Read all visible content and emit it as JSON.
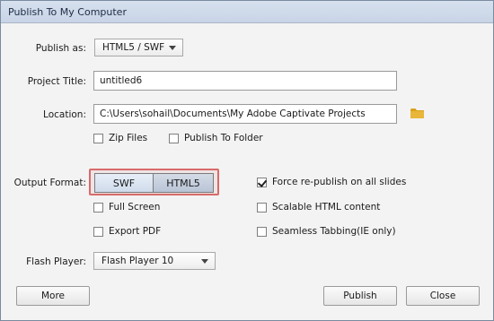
{
  "window": {
    "title": "Publish To My Computer"
  },
  "publish_as": {
    "label": "Publish as:",
    "value": "HTML5 / SWF"
  },
  "project_title": {
    "label": "Project Title:",
    "value": "untitled6"
  },
  "location": {
    "label": "Location:",
    "value": "C:\\Users\\sohail\\Documents\\My Adobe Captivate Projects",
    "icon": "folder-icon"
  },
  "options": {
    "zip_files": {
      "label": "Zip Files",
      "checked": false
    },
    "publish_to_folder": {
      "label": "Publish To Folder",
      "checked": false
    }
  },
  "output_format": {
    "label": "Output Format:",
    "swf": "SWF",
    "html5": "HTML5"
  },
  "left_checks": {
    "full_screen": {
      "label": "Full Screen",
      "checked": false
    },
    "export_pdf": {
      "label": "Export PDF",
      "checked": false
    }
  },
  "right_checks": {
    "force_republish": {
      "label": "Force re-publish on all slides",
      "checked": true
    },
    "scalable_html": {
      "label": "Scalable HTML content",
      "checked": false
    },
    "seamless_tabbing": {
      "label": "Seamless Tabbing(IE only)",
      "checked": false
    }
  },
  "flash_player": {
    "label": "Flash Player:",
    "value": "Flash Player 10"
  },
  "buttons": {
    "more": "More",
    "publish": "Publish",
    "close": "Close"
  },
  "colors": {
    "highlight_border": "#d86a6a",
    "folder": "#d9a21b"
  }
}
